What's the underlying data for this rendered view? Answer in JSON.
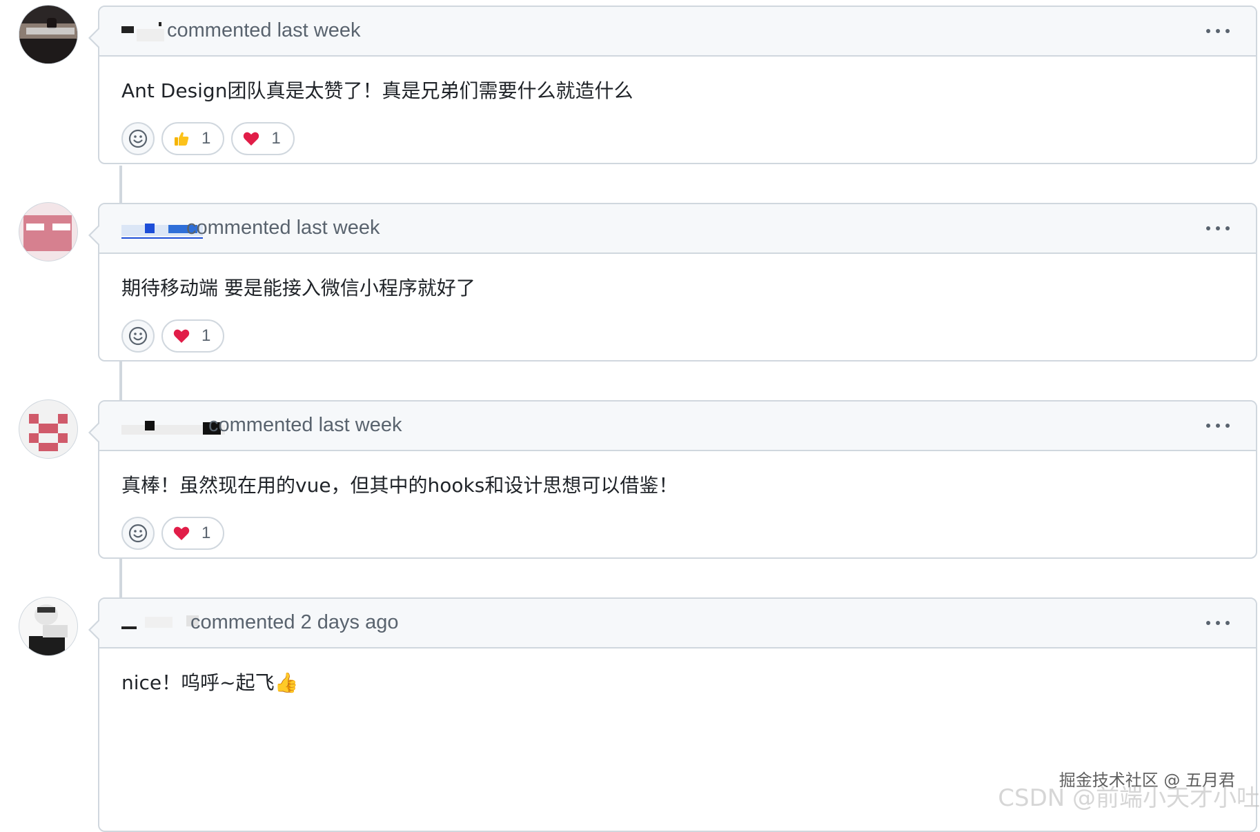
{
  "comments": [
    {
      "author_hidden": true,
      "meta": "commented last week",
      "body": "Ant Design团队真是太赞了！真是兄弟们需要什么就造什么",
      "reactions": [
        {
          "emoji": "thumbs-up",
          "count": "1"
        },
        {
          "emoji": "heart",
          "count": "1"
        }
      ]
    },
    {
      "author_hidden": true,
      "meta": "commented last week",
      "body": "期待移动端 要是能接入微信小程序就好了",
      "reactions": [
        {
          "emoji": "heart",
          "count": "1"
        }
      ]
    },
    {
      "author_hidden": true,
      "meta": "commented last week",
      "body": "真棒！虽然现在用的vue，但其中的hooks和设计思想可以借鉴！",
      "reactions": [
        {
          "emoji": "heart",
          "count": "1"
        }
      ]
    },
    {
      "author_hidden": true,
      "meta": "commented 2 days ago",
      "body": "nice！呜呼~起飞👍",
      "reactions": []
    }
  ],
  "watermark": {
    "line1": "掘金技术社区 @ 五月君",
    "line2": "CSDN @前端小天才小吐"
  },
  "colors": {
    "border": "#d0d7de",
    "header_bg": "#f6f8fa",
    "muted_text": "#59636e",
    "heart": "#e11d48",
    "thumb": "#f5b400"
  }
}
